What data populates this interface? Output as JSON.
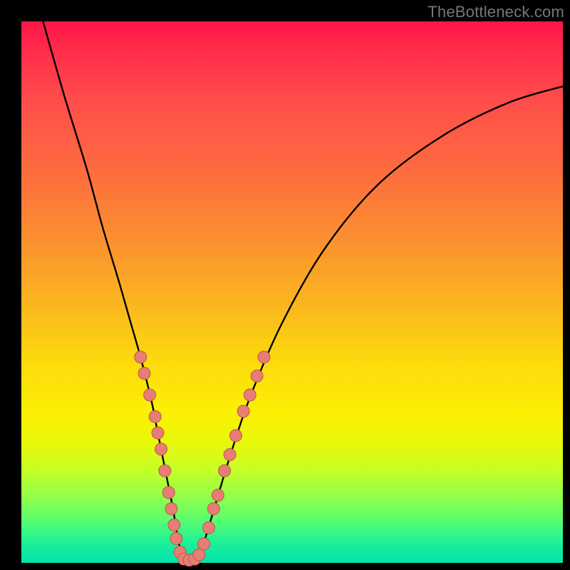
{
  "watermark": "TheBottleneck.com",
  "colors": {
    "curve_stroke": "#000000",
    "dot_fill": "#e77d73",
    "dot_stroke": "#b85a50",
    "bg_black": "#000000"
  },
  "chart_data": {
    "type": "line",
    "title": "",
    "xlabel": "",
    "ylabel": "",
    "xlim": [
      0,
      100
    ],
    "ylim": [
      0,
      100
    ],
    "grid": false,
    "series": [
      {
        "name": "bottleneck-curve",
        "x": [
          4,
          8,
          12,
          15,
          18,
          20,
          22,
          24,
          25,
          26,
          27,
          28,
          29,
          30,
          31,
          33,
          35,
          38,
          42,
          48,
          56,
          66,
          78,
          90,
          100
        ],
        "y": [
          100,
          86,
          73,
          62,
          52,
          45,
          38,
          30,
          25,
          20,
          15,
          10,
          4,
          0.5,
          0.5,
          2,
          8,
          18,
          30,
          44,
          58,
          70,
          79,
          85,
          88
        ]
      }
    ],
    "markers": {
      "name": "highlight-dots",
      "points": [
        {
          "x": 22.0,
          "y": 38
        },
        {
          "x": 22.7,
          "y": 35
        },
        {
          "x": 23.7,
          "y": 31
        },
        {
          "x": 24.7,
          "y": 27
        },
        {
          "x": 25.2,
          "y": 24
        },
        {
          "x": 25.8,
          "y": 21
        },
        {
          "x": 26.5,
          "y": 17
        },
        {
          "x": 27.2,
          "y": 13
        },
        {
          "x": 27.7,
          "y": 10
        },
        {
          "x": 28.2,
          "y": 7
        },
        {
          "x": 28.6,
          "y": 4.5
        },
        {
          "x": 29.3,
          "y": 2
        },
        {
          "x": 30.0,
          "y": 0.7
        },
        {
          "x": 31.0,
          "y": 0.5
        },
        {
          "x": 32.0,
          "y": 0.7
        },
        {
          "x": 32.8,
          "y": 1.5
        },
        {
          "x": 33.7,
          "y": 3.5
        },
        {
          "x": 34.6,
          "y": 6.5
        },
        {
          "x": 35.5,
          "y": 10
        },
        {
          "x": 36.3,
          "y": 12.5
        },
        {
          "x": 37.5,
          "y": 17
        },
        {
          "x": 38.5,
          "y": 20
        },
        {
          "x": 39.6,
          "y": 23.5
        },
        {
          "x": 41.0,
          "y": 28
        },
        {
          "x": 42.2,
          "y": 31
        },
        {
          "x": 43.5,
          "y": 34.5
        },
        {
          "x": 44.8,
          "y": 38
        }
      ]
    }
  }
}
